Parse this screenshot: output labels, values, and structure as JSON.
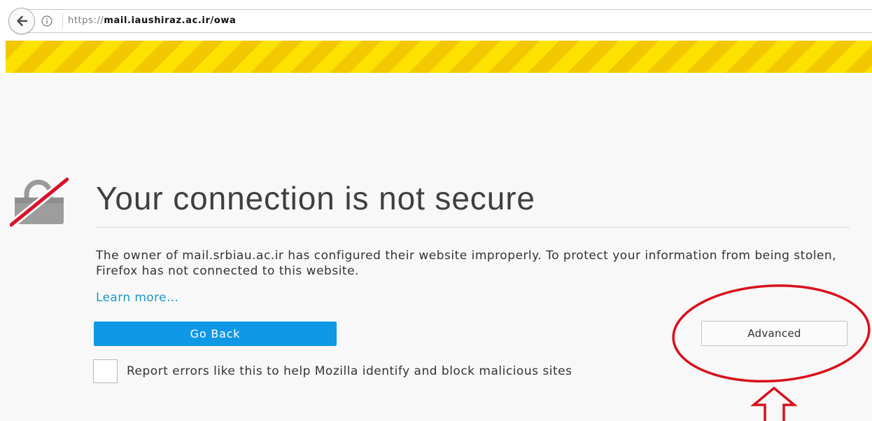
{
  "browser": {
    "url": {
      "scheme": "https://",
      "host": "mail.iaushiraz.ac.ir",
      "path": "/owa"
    },
    "icons": {
      "back": "back-arrow-icon",
      "site_info": "info-icon"
    }
  },
  "error_page": {
    "icon": "broken-lock-icon",
    "title": "Your connection is not secure",
    "description": "The owner of mail.srbiau.ac.ir has configured their website improperly. To protect your information from being stolen, Firefox has not connected to this website.",
    "learn_more_link": "Learn more…",
    "go_back_button": "Go Back",
    "advanced_button": "Advanced",
    "report_errors": {
      "checked": false,
      "label": "Report errors like this to help Mozilla identify and block malicious sites"
    }
  },
  "theme": {
    "warning_stripe_dark": "#f3c800",
    "warning_stripe_light": "#fde200",
    "primary_button": "#0f98e6",
    "link": "#1e97c6",
    "lock_slash": "#d9102a",
    "annotation": "#d8101c"
  }
}
